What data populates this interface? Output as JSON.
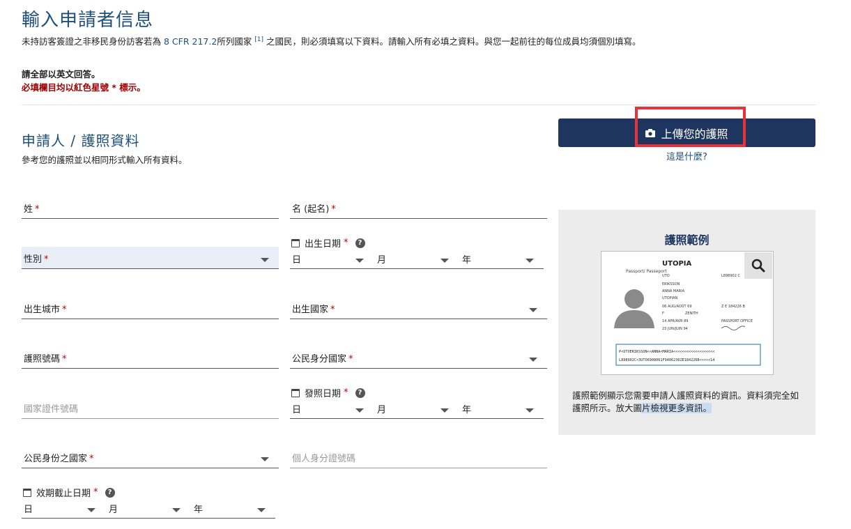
{
  "page": {
    "title": "輸入申請者信息",
    "intro_before": "未持訪客簽證之非移民身份訪客若為",
    "intro_link": "8 CFR 217.2",
    "intro_mid": "所列國家",
    "intro_sup": "[1]",
    "intro_after": "之國民，則必須填寫以下資料。請輸入所有必填之資料。與您一起前往的每位成員均須個別填寫。",
    "note_english": "請全部以英文回答。",
    "note_required": "必填欄目均以紅色星號 * 標示。"
  },
  "section": {
    "title": "申請人 / 護照資料",
    "subtitle": "參考您的護照並以相同形式輸入所有資料。"
  },
  "upload": {
    "button_label": "上傳您的護照",
    "whatis_label": "這是什麼?"
  },
  "fields": {
    "surname": "姓",
    "given_name": "名 (起名)",
    "gender": "性別",
    "dob_label": "出生日期",
    "birth_city": "出生城市",
    "birth_country": "出生國家",
    "passport_number": "護照號碼",
    "citizenship_country": "公民身分國家",
    "issue_date_label": "發照日期",
    "national_id": "國家證件號碼",
    "citizen_country_2": "公民身份之國家",
    "personal_id": "個人身分證號碼",
    "expiry_label": "效期截止日期",
    "required_mark": "*",
    "day": "日",
    "month": "月",
    "year": "年",
    "help": "?"
  },
  "sample": {
    "title": "護照範例",
    "desc_plain": "護照範例顯示您需要申請人護照資料的資訊。資料須完全如護照所示。放大圖",
    "desc_selected": "片檢視更多資訊。",
    "passport_country": "UTOPIA",
    "passport_label": "Passport/ Passeport",
    "surname": "ERIKSSON",
    "given": "ANNA MARIA",
    "nationality": "UTOPIAN",
    "dob": "06 AUG/AOÛT 69",
    "sex": "F",
    "place": "ZENITH",
    "issue": "14 APR/AVR 89",
    "expiry": "23 JUN/JUIN 94",
    "authority": "PASSPORT OFFICE",
    "passport_no": "L898902 C",
    "personal_no": "Z E 184226 B",
    "code": "UTO",
    "mrz1": "P<UTOERIKSSON<<ANNA<MARIA<<<<<<<<<<<<<<<<<<<",
    "mrz2": "L898902C<3UTO6908061F9406236ZE184226B<<<<<14"
  },
  "colors": {
    "accent": "#1e3560",
    "title": "#1d4f7a",
    "required": "#c00000",
    "highlight": "#e8323a"
  }
}
